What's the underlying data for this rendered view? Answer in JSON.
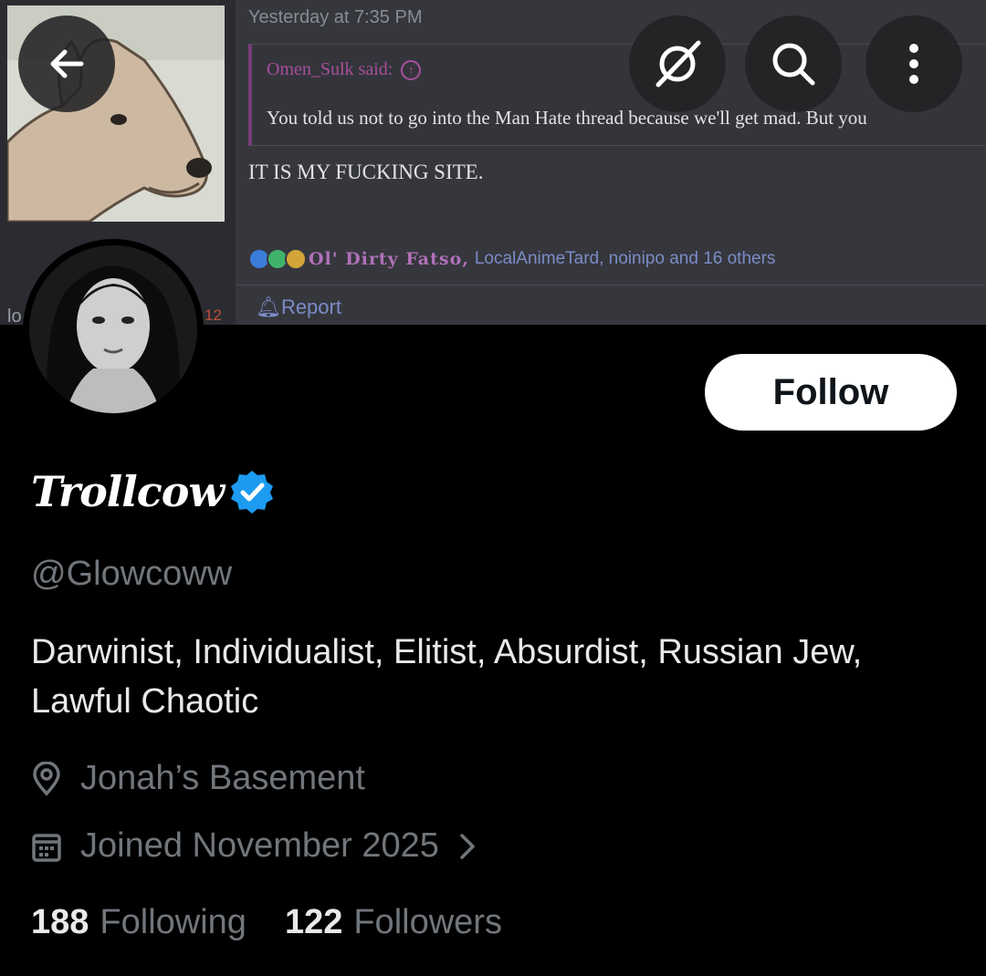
{
  "banner": {
    "post_time": "Yesterday at 7:35 PM",
    "quote_author": "Omen_Sulk said:",
    "quote_text": "You told us not to go into the Man Hate thread because we'll get mad. But you",
    "post_text": "IT IS MY FUCKING SITE.",
    "reaction_first_name": "Ol' Dirty Fatso,",
    "reaction_others": "LocalAnimeTard, noinipo and 16 others",
    "report_label": "Report",
    "username_fragment": "lo",
    "count_fragment": "12"
  },
  "toolbar": {
    "back_icon": "arrow-left-icon",
    "grok_icon": "grok-icon",
    "search_icon": "search-icon",
    "more_icon": "more-vertical-icon"
  },
  "profile": {
    "follow_label": "Follow",
    "display_name": "Trollcow",
    "handle": "@Glowcoww",
    "bio": "Darwinist, Individualist, Elitist, Absurdist, Russian Jew, Lawful Chaotic",
    "location": "Jonah’s Basement",
    "joined": "Joined November 2025",
    "following_count": "188",
    "following_label": "Following",
    "followers_count": "122",
    "followers_label": "Followers"
  },
  "colors": {
    "background": "#000000",
    "verified": "#1d9bf0",
    "secondary_text": "#71767b",
    "quote_accent": "#a64f9a"
  }
}
